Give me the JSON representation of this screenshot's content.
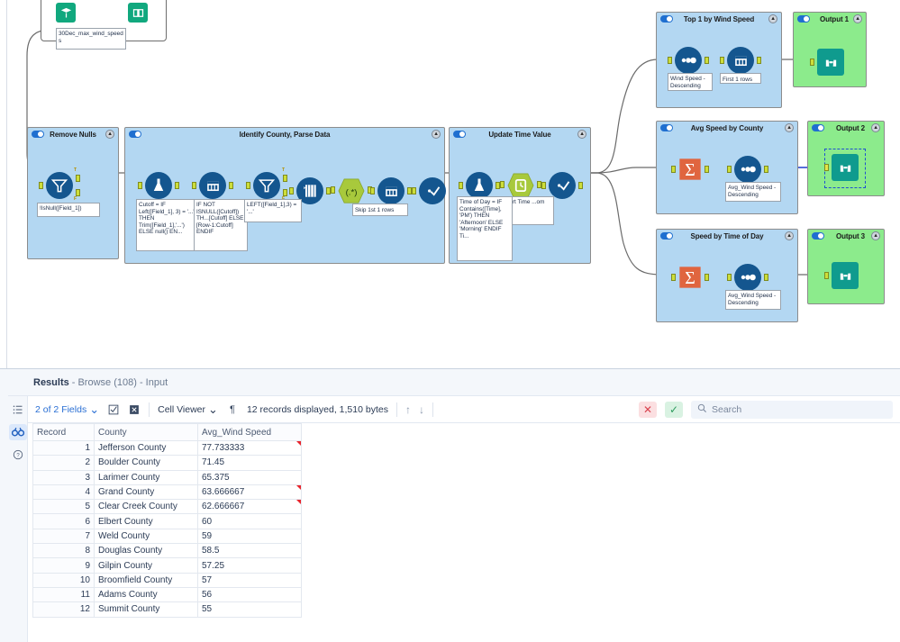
{
  "canvas": {
    "top_tool": {
      "input_icon": "input-data-icon",
      "browse_icon": "table-icon",
      "annotation": "30Dec_max_wind_speeds"
    },
    "containers": [
      {
        "id": "remove-nulls",
        "title": "Remove Nulls",
        "color": "#b3d7f2",
        "tools": [
          {
            "name": "filter-tool",
            "icon": "filter",
            "annotation": "!IsNull([Field_1])"
          }
        ]
      },
      {
        "id": "identify-county-parse-data",
        "title": "Identify County, Parse Data",
        "color": "#b3d7f2",
        "tools": [
          {
            "name": "formula-tool",
            "icon": "formula",
            "annotation": "Cutoff = IF Left([Field_1], 3) = '...' THEN Trim([Field_1],'...') ELSE null() EN..."
          },
          {
            "name": "multi-row-formula-tool",
            "icon": "multirow",
            "annotation": "IF NOT ISNULL([Cutoff]) TH...[Cutoff] ELSE [Row-1:Cutoff] ENDIF"
          },
          {
            "name": "filter-tool",
            "icon": "filter",
            "annotation": "LEFT([Field_1],3) = '...'"
          },
          {
            "name": "text-to-columns-tool",
            "icon": "texttocolumns",
            "annotation": ""
          },
          {
            "name": "regex-tool",
            "icon": "regex",
            "annotation": ""
          },
          {
            "name": "sample-tool",
            "icon": "sample",
            "annotation": "Skip 1st 1 rows"
          },
          {
            "name": "select-tool",
            "icon": "select",
            "annotation": ""
          }
        ]
      },
      {
        "id": "update-time-value",
        "title": "Update Time Value",
        "color": "#b3d7f2",
        "tools": [
          {
            "name": "formula-tool",
            "icon": "formula",
            "annotation": "Time of Day = IF Contains([Time], 'PM') THEN 'Afternoon' ELSE 'Morning' ENDIF Ti..."
          },
          {
            "name": "datetime-tool",
            "icon": "datetime",
            "annotation": "...ert Time ...om"
          },
          {
            "name": "select-tool",
            "icon": "select",
            "annotation": ""
          }
        ]
      },
      {
        "id": "top-1-by-wind-speed",
        "title": "Top 1 by Wind Speed",
        "color": "#b3d7f2",
        "tools": [
          {
            "name": "sort-tool",
            "icon": "sort",
            "annotation": "Wind Speed - Descending"
          },
          {
            "name": "sample-tool",
            "icon": "sample",
            "annotation": "First 1 rows"
          }
        ]
      },
      {
        "id": "output-1",
        "title": "Output 1",
        "color": "#8ceb8c",
        "tools": [
          {
            "name": "browse-tool",
            "icon": "browse",
            "annotation": ""
          }
        ]
      },
      {
        "id": "avg-speed-by-county",
        "title": "Avg Speed by County",
        "color": "#b3d7f2",
        "tools": [
          {
            "name": "summarize-tool",
            "icon": "summarize",
            "annotation": ""
          },
          {
            "name": "sort-tool",
            "icon": "sort",
            "annotation": "Avg_Wind Speed - Descending"
          }
        ]
      },
      {
        "id": "output-2",
        "title": "Output 2",
        "color": "#8ceb8c",
        "selected": true,
        "tools": [
          {
            "name": "browse-tool",
            "icon": "browse",
            "annotation": ""
          }
        ]
      },
      {
        "id": "speed-by-time-of-day",
        "title": "Speed by Time of Day",
        "color": "#b3d7f2",
        "tools": [
          {
            "name": "summarize-tool",
            "icon": "summarize",
            "annotation": ""
          },
          {
            "name": "sort-tool",
            "icon": "sort",
            "annotation": "Avg_Wind Speed - Descending"
          }
        ]
      },
      {
        "id": "output-3",
        "title": "Output 3",
        "color": "#8ceb8c",
        "tools": [
          {
            "name": "browse-tool",
            "icon": "browse",
            "annotation": ""
          }
        ]
      }
    ]
  },
  "results": {
    "title_bold": "Results",
    "title_rest": "- Browse (108) - Input",
    "rail": [
      {
        "name": "list-icon",
        "glyph": "☰",
        "active": false
      },
      {
        "name": "binoculars-icon",
        "glyph": "∞",
        "active": true
      },
      {
        "name": "help-icon",
        "glyph": "?",
        "active": false
      }
    ],
    "toolbar": {
      "fields_label": "2 of 2 Fields",
      "fields_caret": "⌄",
      "check_icon": "checkbox-icon",
      "x_icon": "deselect-icon",
      "cell_viewer_label": "Cell Viewer",
      "cell_viewer_caret": "⌄",
      "pilcrow": "¶",
      "records_text": "12 records displayed, 1,510 bytes",
      "up_arrow": "↑",
      "down_arrow": "↓",
      "reject_icon": "✕",
      "accept_icon": "✓",
      "search_icon": "search-icon",
      "search_placeholder": "Search"
    },
    "grid": {
      "columns": [
        "Record",
        "County",
        "Avg_Wind Speed"
      ],
      "rows": [
        {
          "record": "1",
          "county": "Jefferson County",
          "speed": "77.733333",
          "flag": true
        },
        {
          "record": "2",
          "county": "Boulder County",
          "speed": "71.45",
          "flag": false
        },
        {
          "record": "3",
          "county": "Larimer County",
          "speed": "65.375",
          "flag": false
        },
        {
          "record": "4",
          "county": "Grand County",
          "speed": "63.666667",
          "flag": true
        },
        {
          "record": "5",
          "county": "Clear Creek County",
          "speed": "62.666667",
          "flag": true
        },
        {
          "record": "6",
          "county": "Elbert County",
          "speed": "60",
          "flag": false
        },
        {
          "record": "7",
          "county": "Weld County",
          "speed": "59",
          "flag": false
        },
        {
          "record": "8",
          "county": "Douglas County",
          "speed": "58.5",
          "flag": false
        },
        {
          "record": "9",
          "county": "Gilpin County",
          "speed": "57.25",
          "flag": false
        },
        {
          "record": "10",
          "county": "Broomfield County",
          "speed": "57",
          "flag": false
        },
        {
          "record": "11",
          "county": "Adams County",
          "speed": "56",
          "flag": false
        },
        {
          "record": "12",
          "county": "Summit County",
          "speed": "55",
          "flag": false
        }
      ]
    }
  },
  "colors": {
    "container_blue": "#b3d7f2",
    "container_green": "#8ceb8c",
    "tool_navy": "#14568f",
    "regex_green": "#a8c93c",
    "summarize_orange": "#e0653f",
    "browse_teal": "#0f9b8e",
    "anchor_yellow": "#cdde3a",
    "header_underline_green": "#7ede3f",
    "link_blue": "#2a6fd4",
    "selected_blue": "#1f4fd0"
  }
}
